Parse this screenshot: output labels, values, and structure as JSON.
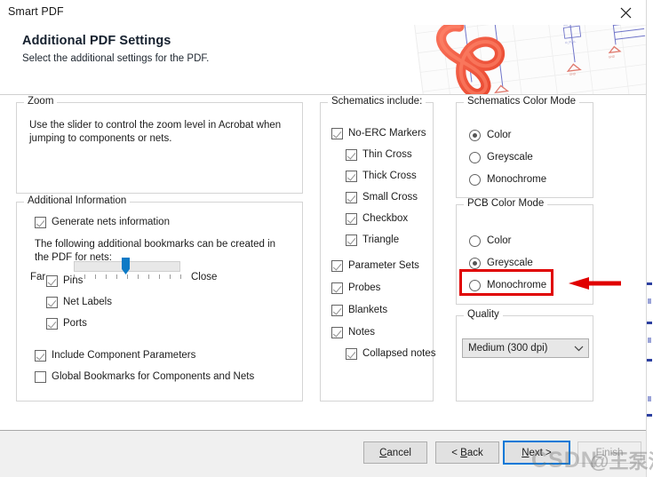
{
  "window": {
    "title": "Smart PDF",
    "close_icon": "close-icon"
  },
  "header": {
    "title": "Additional PDF Settings",
    "subtitle": "Select the additional settings for the PDF."
  },
  "zoom_group": {
    "legend": "Zoom",
    "description": "Use the slider to control the zoom level in Acrobat when jumping to components or nets.",
    "min_label": "Far",
    "max_label": "Close",
    "value": 5,
    "min": 0,
    "max": 10,
    "tick_count": 11
  },
  "additional_info_group": {
    "legend": "Additional Information",
    "generate_nets": {
      "label": "Generate nets information",
      "checked": true
    },
    "note": "The following additional bookmarks can be created in the PDF for nets:",
    "net_items": [
      {
        "label": "Pins",
        "checked": true
      },
      {
        "label": "Net Labels",
        "checked": true
      },
      {
        "label": "Ports",
        "checked": true
      }
    ],
    "bottom_items": [
      {
        "label": "Include Component Parameters",
        "checked": true
      },
      {
        "label": "Global Bookmarks for Components and Nets",
        "checked": false
      }
    ]
  },
  "schematics_include_group": {
    "legend": "Schematics include:",
    "items": [
      {
        "label": "No-ERC Markers",
        "checked": true,
        "indent": 0
      },
      {
        "label": "Thin Cross",
        "checked": true,
        "indent": 1
      },
      {
        "label": "Thick Cross",
        "checked": true,
        "indent": 1
      },
      {
        "label": "Small Cross",
        "checked": true,
        "indent": 1
      },
      {
        "label": "Checkbox",
        "checked": true,
        "indent": 1
      },
      {
        "label": "Triangle",
        "checked": true,
        "indent": 1
      },
      {
        "label": "Parameter Sets",
        "checked": true,
        "indent": 0
      },
      {
        "label": "Probes",
        "checked": true,
        "indent": 0
      },
      {
        "label": "Blankets",
        "checked": true,
        "indent": 0
      },
      {
        "label": "Notes",
        "checked": true,
        "indent": 0
      },
      {
        "label": "Collapsed notes",
        "checked": true,
        "indent": 1
      }
    ]
  },
  "schematics_color_mode_group": {
    "legend": "Schematics Color Mode",
    "options": [
      {
        "label": "Color",
        "selected": true
      },
      {
        "label": "Greyscale",
        "selected": false
      },
      {
        "label": "Monochrome",
        "selected": false
      }
    ]
  },
  "pcb_color_mode_group": {
    "legend": "PCB Color Mode",
    "options": [
      {
        "label": "Color",
        "selected": false
      },
      {
        "label": "Greyscale",
        "selected": true
      },
      {
        "label": "Monochrome",
        "selected": false
      }
    ]
  },
  "quality_group": {
    "legend": "Quality",
    "selected": "Medium (300 dpi)",
    "dropdown_icon": "chevron-down-icon"
  },
  "footer": {
    "buttons": [
      {
        "name": "cancel",
        "pre": "",
        "accel": "C",
        "post": "ancel",
        "state": "normal"
      },
      {
        "name": "back",
        "pre": "< ",
        "accel": "B",
        "post": "ack",
        "state": "normal"
      },
      {
        "name": "next",
        "pre": "",
        "accel": "N",
        "post": "ext >",
        "state": "focused"
      },
      {
        "name": "finish",
        "pre": "",
        "accel": "F",
        "post": "inish",
        "state": "disabled"
      }
    ]
  },
  "annotation": {
    "highlight_target": "Monochrome",
    "color": "#e00000"
  },
  "watermark": {
    "brand": "CSDN",
    "user": "@王泵涛"
  }
}
